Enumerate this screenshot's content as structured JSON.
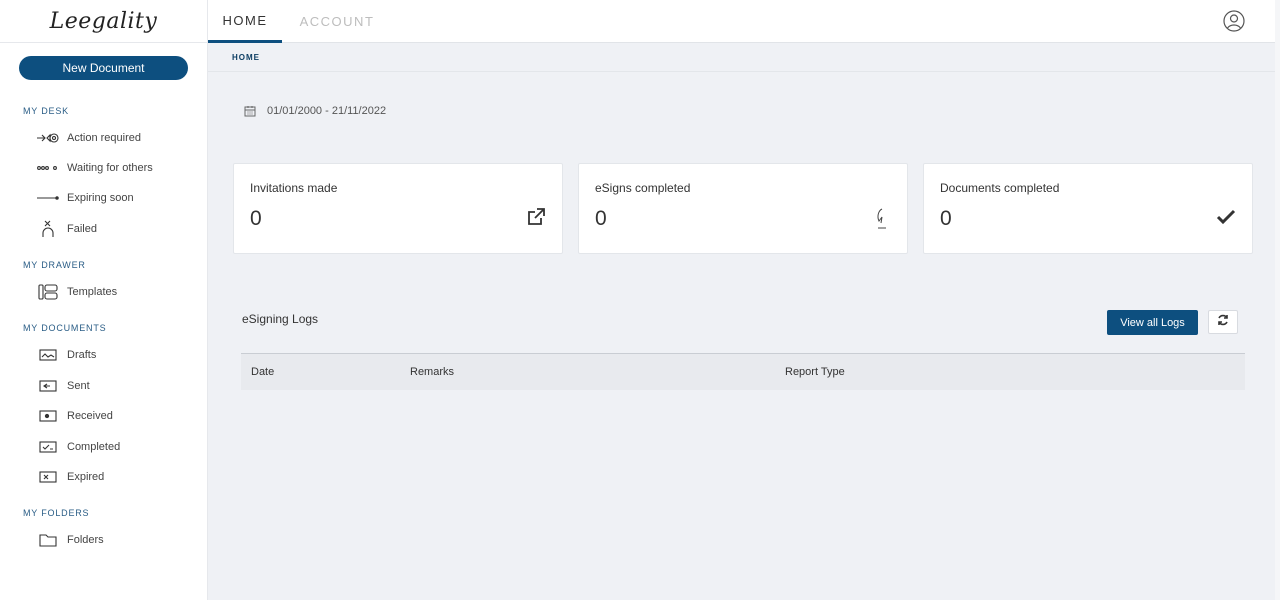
{
  "app": {
    "logo_text": "Leegality"
  },
  "sidebar": {
    "new_document": "New Document",
    "sections": {
      "desk": "MY DESK",
      "drawer": "MY DRAWER",
      "documents": "MY DOCUMENTS",
      "folders": "MY FOLDERS"
    },
    "items": {
      "action_required": "Action required",
      "waiting": "Waiting for others",
      "expiring": "Expiring soon",
      "failed": "Failed",
      "templates": "Templates",
      "drafts": "Drafts",
      "sent": "Sent",
      "received": "Received",
      "completed": "Completed",
      "expired": "Expired",
      "folders": "Folders"
    }
  },
  "header": {
    "tabs": {
      "home": "HOME",
      "account": "ACCOUNT"
    },
    "breadcrumb": "HOME"
  },
  "main": {
    "date_range": "01/01/2000 - 21/11/2022",
    "cards": {
      "invitations": {
        "title": "Invitations made",
        "value": "0"
      },
      "esigns": {
        "title": "eSigns completed",
        "value": "0"
      },
      "documents": {
        "title": "Documents completed",
        "value": "0"
      }
    },
    "logs": {
      "title": "eSigning Logs",
      "view_all": "View all Logs",
      "columns": {
        "date": "Date",
        "remarks": "Remarks",
        "report_type": "Report Type"
      }
    }
  },
  "colors": {
    "primary": "#0d4f7f",
    "background": "#eff1f5"
  }
}
